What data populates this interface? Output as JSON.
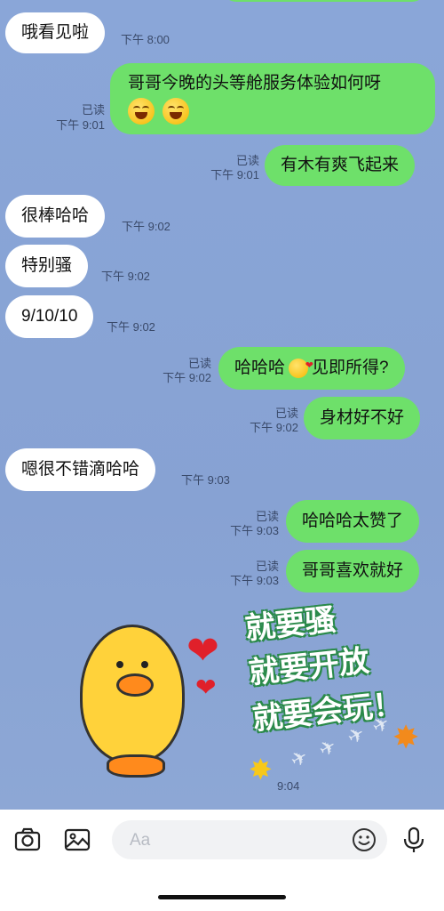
{
  "messages": [
    {
      "dir": "in",
      "text": "哦看见啦",
      "time": "下午 8:00"
    },
    {
      "dir": "out",
      "line1": "哥哥今晚的头等舱服务体验如何呀",
      "emoji": "laughing-tears-emoji",
      "read": "已读",
      "time": "下午 9:01"
    },
    {
      "dir": "out",
      "text": "有木有爽飞起来",
      "read": "已读",
      "time": "下午 9:01"
    },
    {
      "dir": "in",
      "text": "很棒哈哈",
      "time": "下午 9:02"
    },
    {
      "dir": "in",
      "text": "特别骚",
      "time": "下午 9:02"
    },
    {
      "dir": "in",
      "text": "9/10/10",
      "time": "下午 9:02"
    },
    {
      "dir": "out",
      "text_before": "哈哈哈",
      "emoji": "kiss-emoji",
      "text_after": "见即所得?",
      "read": "已读",
      "time": "下午 9:02"
    },
    {
      "dir": "out",
      "text": "身材好不好",
      "read": "已读",
      "time": "下午 9:02"
    },
    {
      "dir": "in",
      "text": "嗯很不错滴哈哈",
      "time": "下午 9:03"
    },
    {
      "dir": "out",
      "text": "哈哈哈太赞了",
      "read": "已读",
      "time": "下午 9:03"
    },
    {
      "dir": "out",
      "text": "哥哥喜欢就好",
      "read": "已读",
      "time": "下午 9:03"
    }
  ],
  "sticker": {
    "lines": [
      "就要骚",
      "就要开放",
      "就要会玩！"
    ],
    "time": "9:04",
    "colors": {
      "duck": "#ffd23a",
      "beak": "#ff8a1c",
      "heart": "#e0202a",
      "text_outline": "#2a8a4a"
    }
  },
  "input_bar": {
    "placeholder": "Aa",
    "icons": [
      "camera-icon",
      "image-icon",
      "emoji-icon",
      "microphone-icon"
    ]
  },
  "colors": {
    "outgoing_bubble": "#6ee06a",
    "incoming_bubble": "#ffffff",
    "background": "#8aa6d8"
  }
}
